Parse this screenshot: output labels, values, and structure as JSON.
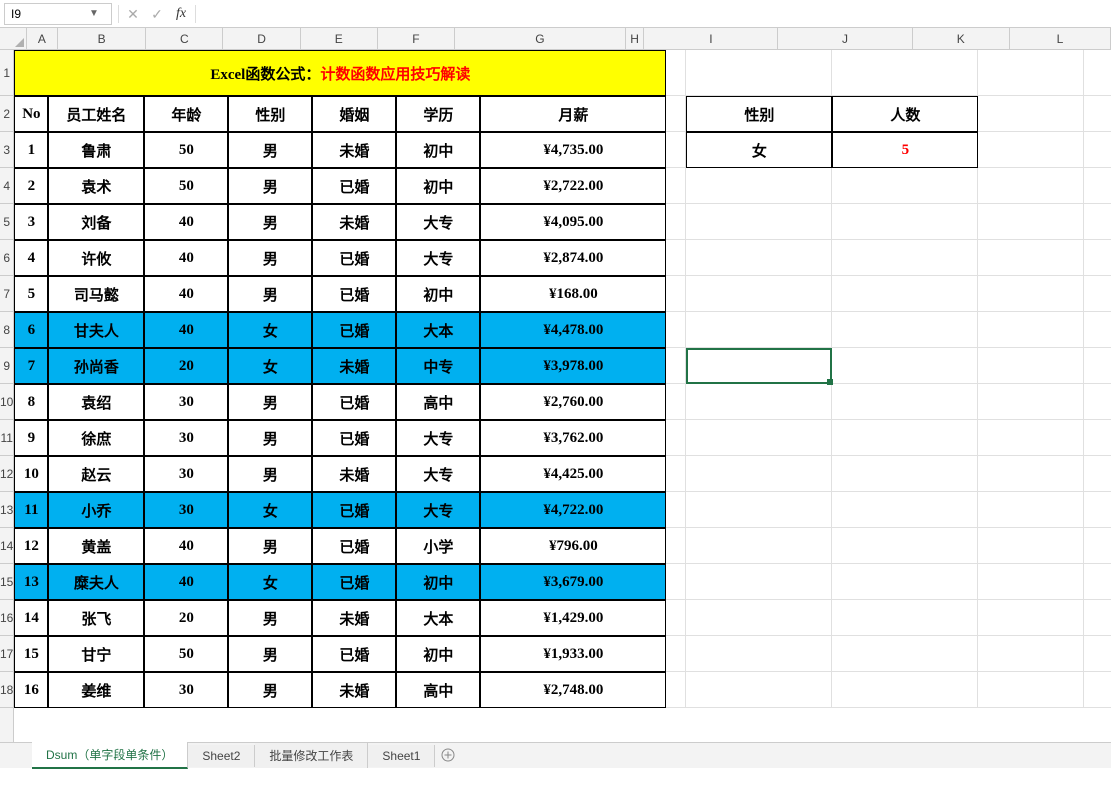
{
  "namebox": {
    "value": "I9"
  },
  "formula": {
    "value": ""
  },
  "colWidths": {
    "A": 34,
    "B": 96,
    "C": 84,
    "D": 84,
    "E": 84,
    "F": 84,
    "G": 186,
    "H": 20,
    "I": 146,
    "J": 146,
    "K": 106,
    "L": 110
  },
  "columns": [
    "A",
    "B",
    "C",
    "D",
    "E",
    "F",
    "G",
    "H",
    "I",
    "J",
    "K",
    "L"
  ],
  "rowCount": 18,
  "title": {
    "black": "Excel函数公式：",
    "red": "计数函数应用技巧解读"
  },
  "headers": {
    "no": "No",
    "name": "员工姓名",
    "age": "年龄",
    "gender": "性别",
    "marriage": "婚姻",
    "edu": "学历",
    "salary": "月薪"
  },
  "rows": [
    {
      "no": "1",
      "name": "鲁肃",
      "age": "50",
      "gender": "男",
      "marriage": "未婚",
      "edu": "初中",
      "salary": "¥4,735.00",
      "hl": false
    },
    {
      "no": "2",
      "name": "袁术",
      "age": "50",
      "gender": "男",
      "marriage": "已婚",
      "edu": "初中",
      "salary": "¥2,722.00",
      "hl": false
    },
    {
      "no": "3",
      "name": "刘备",
      "age": "40",
      "gender": "男",
      "marriage": "未婚",
      "edu": "大专",
      "salary": "¥4,095.00",
      "hl": false
    },
    {
      "no": "4",
      "name": "许攸",
      "age": "40",
      "gender": "男",
      "marriage": "已婚",
      "edu": "大专",
      "salary": "¥2,874.00",
      "hl": false
    },
    {
      "no": "5",
      "name": "司马懿",
      "age": "40",
      "gender": "男",
      "marriage": "已婚",
      "edu": "初中",
      "salary": "¥168.00",
      "hl": false
    },
    {
      "no": "6",
      "name": "甘夫人",
      "age": "40",
      "gender": "女",
      "marriage": "已婚",
      "edu": "大本",
      "salary": "¥4,478.00",
      "hl": true
    },
    {
      "no": "7",
      "name": "孙尚香",
      "age": "20",
      "gender": "女",
      "marriage": "未婚",
      "edu": "中专",
      "salary": "¥3,978.00",
      "hl": true
    },
    {
      "no": "8",
      "name": "袁绍",
      "age": "30",
      "gender": "男",
      "marriage": "已婚",
      "edu": "高中",
      "salary": "¥2,760.00",
      "hl": false
    },
    {
      "no": "9",
      "name": "徐庶",
      "age": "30",
      "gender": "男",
      "marriage": "已婚",
      "edu": "大专",
      "salary": "¥3,762.00",
      "hl": false
    },
    {
      "no": "10",
      "name": "赵云",
      "age": "30",
      "gender": "男",
      "marriage": "未婚",
      "edu": "大专",
      "salary": "¥4,425.00",
      "hl": false
    },
    {
      "no": "11",
      "name": "小乔",
      "age": "30",
      "gender": "女",
      "marriage": "已婚",
      "edu": "大专",
      "salary": "¥4,722.00",
      "hl": true
    },
    {
      "no": "12",
      "name": "黄盖",
      "age": "40",
      "gender": "男",
      "marriage": "已婚",
      "edu": "小学",
      "salary": "¥796.00",
      "hl": false
    },
    {
      "no": "13",
      "name": "糜夫人",
      "age": "40",
      "gender": "女",
      "marriage": "已婚",
      "edu": "初中",
      "salary": "¥3,679.00",
      "hl": true
    },
    {
      "no": "14",
      "name": "张飞",
      "age": "20",
      "gender": "男",
      "marriage": "未婚",
      "edu": "大本",
      "salary": "¥1,429.00",
      "hl": false
    },
    {
      "no": "15",
      "name": "甘宁",
      "age": "50",
      "gender": "男",
      "marriage": "已婚",
      "edu": "初中",
      "salary": "¥1,933.00",
      "hl": false
    },
    {
      "no": "16",
      "name": "姜维",
      "age": "30",
      "gender": "男",
      "marriage": "未婚",
      "edu": "高中",
      "salary": "¥2,748.00",
      "hl": false
    }
  ],
  "side": {
    "headers": {
      "gender": "性别",
      "count": "人数"
    },
    "value": {
      "gender": "女",
      "count": "5"
    }
  },
  "sheets": {
    "tabs": [
      {
        "label": "Dsum（单字段单条件）",
        "active": true
      },
      {
        "label": "Sheet2",
        "active": false
      },
      {
        "label": "批量修改工作表",
        "active": false
      },
      {
        "label": "Sheet1",
        "active": false
      }
    ]
  }
}
